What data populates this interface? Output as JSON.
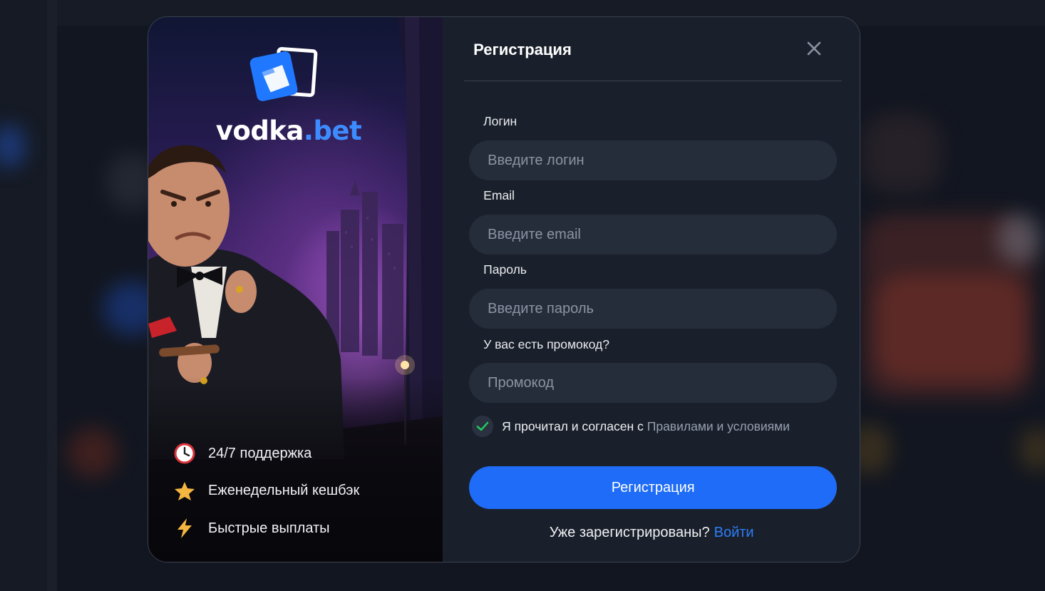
{
  "brand": {
    "name_main": "vodka",
    "name_tld": ".bet"
  },
  "features": [
    {
      "icon": "clock-icon",
      "label": "24/7 поддержка"
    },
    {
      "icon": "star-icon",
      "label": "Еженедельный кешбэк"
    },
    {
      "icon": "lightning-icon",
      "label": "Быстрые выплаты"
    }
  ],
  "form": {
    "title": "Регистрация",
    "fields": [
      {
        "label": "Логин",
        "placeholder": "Введите логин",
        "value": ""
      },
      {
        "label": "Email",
        "placeholder": "Введите email",
        "value": ""
      },
      {
        "label": "Пароль",
        "placeholder": "Введите пароль",
        "value": ""
      },
      {
        "label": "У вас есть промокод?",
        "placeholder": "Промокод",
        "value": ""
      }
    ],
    "agree_text": "Я прочитал и согласен с",
    "agree_link": "Правилами и условиями",
    "agree_checked": true,
    "submit_label": "Регистрация",
    "login_question": "Уже зарегистрированы?",
    "login_link": "Войти"
  },
  "colors": {
    "accent": "#1e6cf7",
    "link": "#2c7df8",
    "check": "#22c55e",
    "panel": "#1a202b",
    "input_bg": "#262d3a"
  }
}
